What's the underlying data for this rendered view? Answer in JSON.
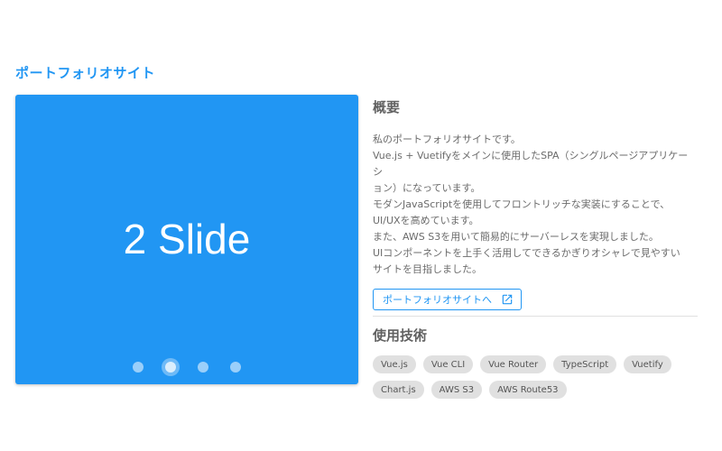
{
  "page": {
    "title": "ポートフォリオサイト"
  },
  "carousel": {
    "slide_text": "2 Slide",
    "slide_count": 4,
    "active_index": 1,
    "background_color": "#2196f3"
  },
  "overview": {
    "heading": "概要",
    "lines": [
      "私のポートフォリオサイトです。",
      "Vue.js + Vuetifyをメインに使用したSPA（シングルページアプリケーシ",
      "ョン）になっています。",
      "モダンJavaScriptを使用してフロントリッチな実装にすることで、",
      "UI/UXを高めています。",
      "また、AWS S3を用いて簡易的にサーバーレスを実現しました。",
      "UIコンポーネントを上手く活用してできるかぎりオシャレで見やすい",
      "サイトを目指しました。"
    ],
    "link_label": "ポートフォリオサイトへ",
    "link_icon": "open-in-new-icon"
  },
  "tech": {
    "heading": "使用技術",
    "chips": [
      "Vue.js",
      "Vue CLI",
      "Vue Router",
      "TypeScript",
      "Vuetify",
      "Chart.js",
      "AWS S3",
      "AWS Route53"
    ]
  },
  "colors": {
    "accent": "#2196f3",
    "chip_bg": "#e0e0e0"
  }
}
